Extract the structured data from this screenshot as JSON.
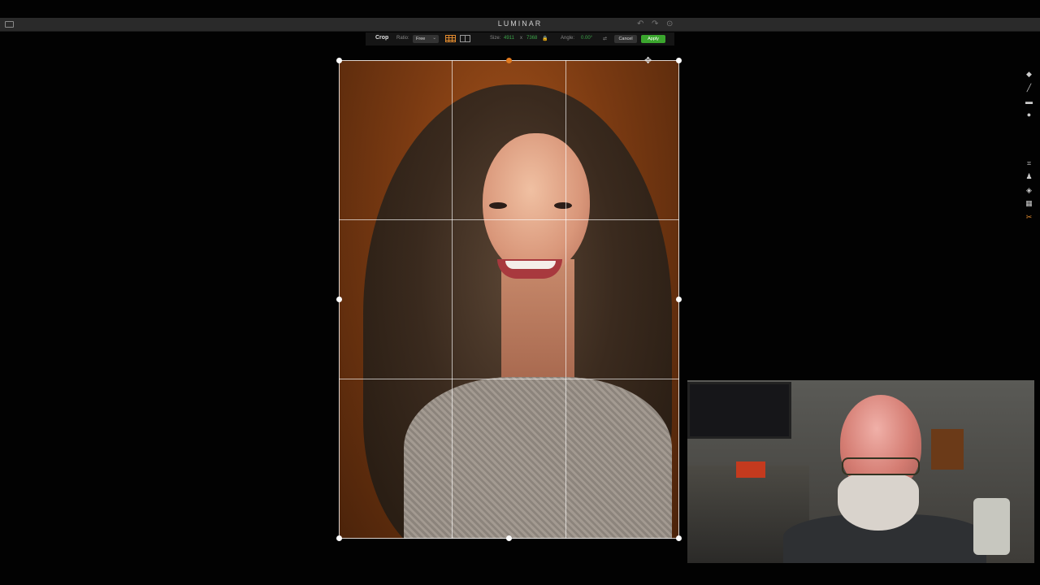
{
  "app": {
    "title": "LUMINAR"
  },
  "titlebar_icons": {
    "left": "folder-icon",
    "right": [
      "undo-icon",
      "redo-icon",
      "history-icon"
    ]
  },
  "toolbar": {
    "tool_label": "Crop",
    "ratio_label": "Ratio:",
    "ratio_value": "Free",
    "size_label": "Size:",
    "size_width": "4911",
    "size_sep": "x",
    "size_height": "7368",
    "angle_label": "Angle:",
    "angle_value": "0.00°",
    "cancel_label": "Cancel",
    "apply_label": "Apply"
  },
  "colors": {
    "accent": "#e08a2e",
    "apply_green": "#3ba62e",
    "value_green": "#3da64a"
  },
  "right_rail": {
    "top_group": [
      "layers-icon",
      "brush-icon",
      "mask-icon",
      "circle-icon"
    ],
    "bottom_group": [
      "crop-transform-icon",
      "stamp-icon",
      "erase-icon",
      "noise-icon",
      "scissors-icon"
    ]
  }
}
